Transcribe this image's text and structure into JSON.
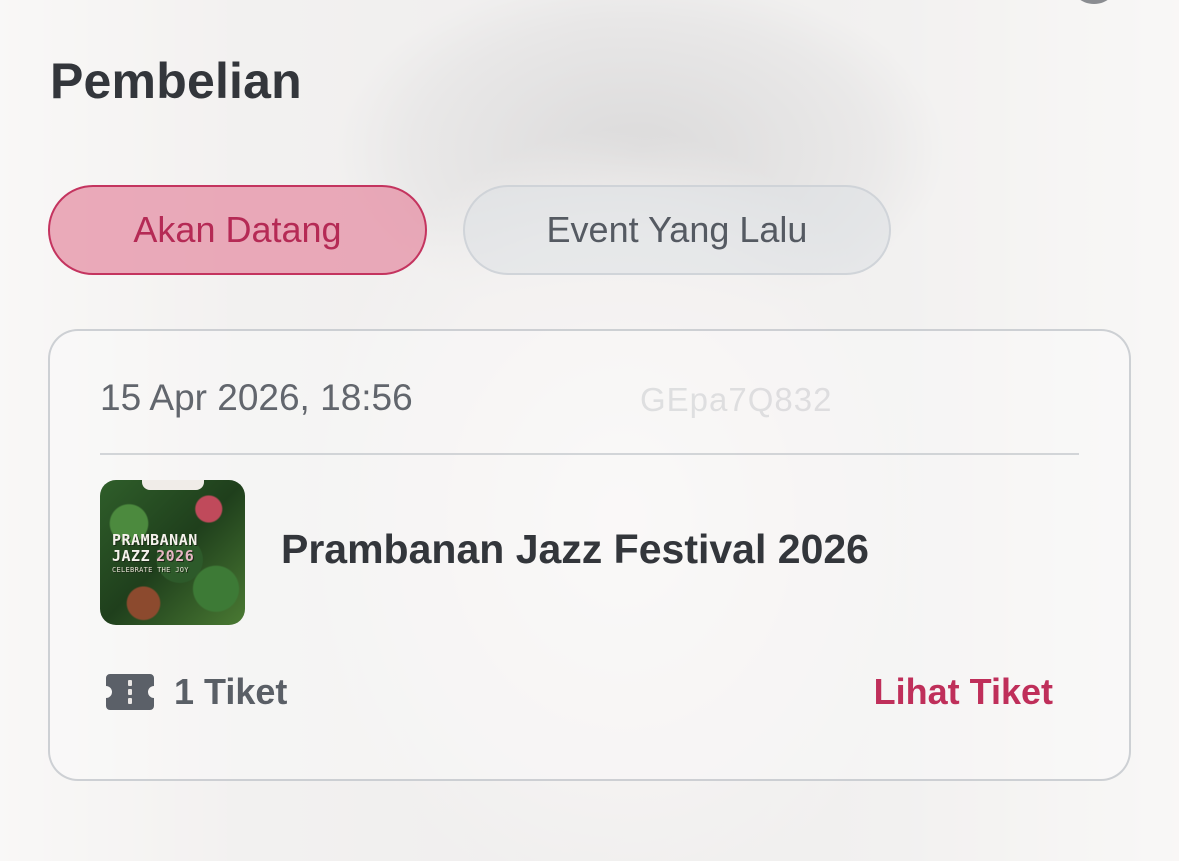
{
  "header": {
    "title": "Pembelian"
  },
  "tabs": [
    {
      "label": "Akan Datang",
      "active": true
    },
    {
      "label": "Event Yang Lalu",
      "active": false
    }
  ],
  "purchase": {
    "datetime": "15 Apr 2026, 18:56",
    "order_code": "GEpa7Q832",
    "event": {
      "name": "Prambanan Jazz Festival 2026",
      "poster": {
        "line1": "PRAMBANAN",
        "line2": "JAZZ",
        "year": "2026",
        "tagline": "CELEBRATE THE JOY"
      }
    },
    "ticket_count_label": "1 Tiket",
    "ticket_icon": "ticket-icon",
    "view_label": "Lihat Tiket"
  },
  "colors": {
    "accent": "#bf2f5a",
    "active_tab_bg": "#e48ca2",
    "text_dark": "#33363b",
    "text_muted": "#62666d"
  }
}
